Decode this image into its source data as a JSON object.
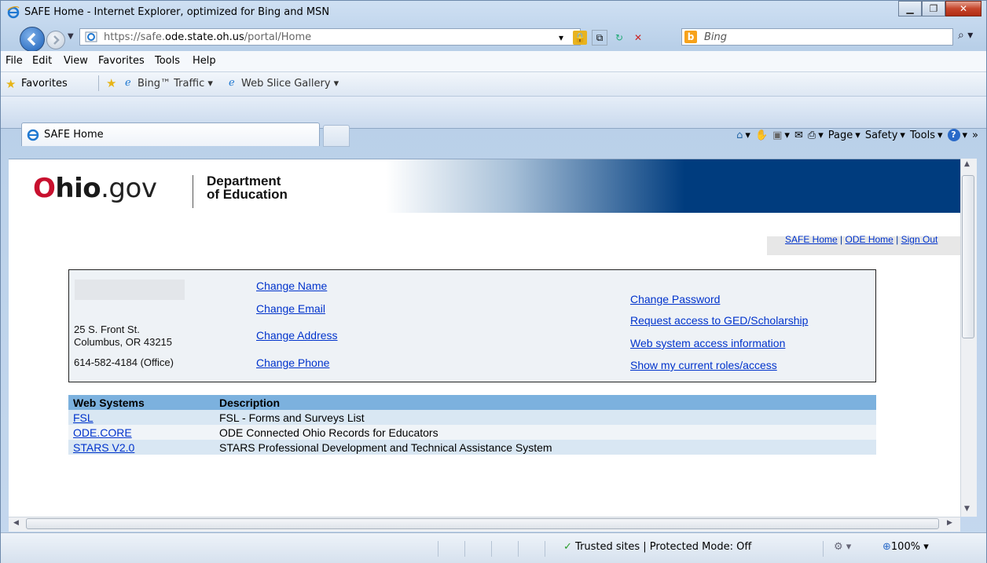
{
  "window": {
    "title": "SAFE Home - Internet Explorer, optimized for Bing and MSN"
  },
  "address_bar": {
    "url_prefix": "https://safe.",
    "url_domain": "ode.state.oh.us",
    "url_suffix": "/portal/Home"
  },
  "search": {
    "placeholder": "Bing"
  },
  "menu": {
    "file": "File",
    "edit": "Edit",
    "view": "View",
    "favorites": "Favorites",
    "tools": "Tools",
    "help": "Help"
  },
  "favorites_bar": {
    "favorites": "Favorites",
    "item1": "Bing™ Traffic ▾",
    "item2": "Web Slice Gallery ▾"
  },
  "tab": {
    "label": "SAFE Home"
  },
  "command_bar": {
    "page": "Page",
    "safety": "Safety",
    "tools": "Tools"
  },
  "page": {
    "logo": {
      "o": "O",
      "hio": "hio",
      "gov": ".gov"
    },
    "dept_line1": "Department",
    "dept_line2": "of Education",
    "top_links": {
      "safe_home": "SAFE Home",
      "sep1": " | ",
      "ode_home": "ODE Home",
      "sep2": " | ",
      "sign_out": "Sign Out"
    },
    "profile": {
      "street": "25 S. Front St.",
      "city": "Columbus, OR 43215",
      "phone": "614-582-4184 (Office)"
    },
    "profile_links": {
      "change_name": "Change Name",
      "change_email": "Change Email",
      "change_address": "Change Address",
      "change_phone": "Change Phone",
      "change_password": "Change Password",
      "request_access": "Request access to GED/Scholarship",
      "web_access_info": "Web system access information",
      "show_roles": "Show my current roles/access"
    },
    "systems_table": {
      "headers": [
        "Web Systems",
        "Description"
      ],
      "rows": [
        {
          "system": "FSL",
          "description": "FSL - Forms and Surveys List"
        },
        {
          "system": "ODE.CORE",
          "description": "ODE Connected Ohio Records for Educators"
        },
        {
          "system": "STARS V2.0",
          "description": "STARS Professional Development and Technical Assistance System"
        }
      ]
    }
  },
  "status_bar": {
    "zone": "Trusted sites | Protected Mode: Off",
    "zoom": "100%"
  },
  "colors": {
    "link": "#0033cc",
    "table_header": "#7cb1de",
    "banner_blue": "#003c7e",
    "ohio_red": "#c8102e"
  }
}
